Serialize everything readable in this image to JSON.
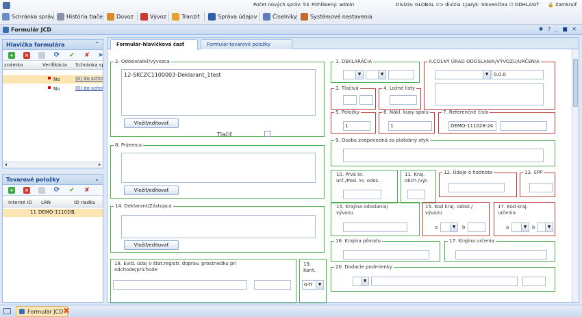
{
  "top": {
    "new_messages_label": "Počet nových správ:",
    "new_messages_count": "53",
    "logged_label": "Prihlásený:",
    "logged_user": "admin",
    "division_label": "Divízia:",
    "division_value": "GLOBAL => divízia 1",
    "language_label": "Jazyk:",
    "language_value": "Slovenčina",
    "logout": "ODHLÁSIŤ",
    "lock": "Zamknúť"
  },
  "nav": [
    "Schránka správ",
    "História tlače",
    "Dovoz",
    "Vývoz",
    "Tranzit",
    "Správa údajov",
    "Číselníky",
    "Systémové nastavenia"
  ],
  "window": {
    "title": "Formulár JCD",
    "tools": "✱ ? _ ■ ✕"
  },
  "header_panel": {
    "title": "Hlavička formulára",
    "columns": [
      "známka",
      "Verifikácia",
      "Schránka sp"
    ],
    "rows": [
      {
        "verif": "No",
        "box": "(0) do schrán"
      },
      {
        "verif": "No",
        "box": "(0) do schrán"
      }
    ]
  },
  "items_panel": {
    "title": "Tovarové položky",
    "columns": [
      "Interné ID",
      "LRN",
      "ID riadku"
    ],
    "rows": [
      {
        "id": "11",
        "lrn": "DEMO-111028",
        "line": "1"
      }
    ]
  },
  "tabs": [
    "Formulár-hlavičková časť",
    "Formulár-tovarové položky"
  ],
  "form": {
    "f2_legend": "2. Odosielateľ/vývozca",
    "f2_text": "12-SKCZC1100003-Deklarant_1test",
    "edit_btn": "Vložiť/editovať",
    "print_label": "Tlačiť",
    "f8_legend": "8. Príjemca",
    "f14_legend": "14. Deklarant/Zástupca",
    "f18_label_1": "18. Evid. údaj o štat.registr. doprav. prostriedku pri",
    "f18_label_2": "odchode/príchode",
    "f19_label_1": "19.",
    "f19_label_2": "Kont.",
    "f19_value": "0-Tr",
    "f1_legend": "1. DEKLARÁCIA",
    "fA_legend": "A.COLNÝ ÚRAD ODOSLANIA/VÝVOZU/URČENIA",
    "fA_value": "0.0.0",
    "f3_legend": "3. Tlačivá",
    "f4_legend": "4. Ložné listy",
    "f5_legend": "5. Položky",
    "f5_value": "1",
    "f6_legend": "6. Nákl. kusy spolu",
    "f6_value": "1",
    "f7_legend": "7. Referenčné číslo",
    "f7_value": "DEMO-111028-24",
    "f9_legend": "9. Osoba zodpovedná za platobný styk",
    "f10_label_1": "10. Prvá kr.",
    "f10_label_2": "urč./Posl. kr. odos.",
    "f11_label_1": "11. Kraj.",
    "f11_label_2": "obch./výr.",
    "f12_legend": "12. Údaje o hodnote",
    "f13_legend": "13. SPP",
    "f15_label_1": "15. Krajina odoslania/",
    "f15_label_2": "vývozu",
    "f15a_label_1": "15. Kod kraj. odosl./",
    "f15a_label_2": "vývozu",
    "f17a_label_1": "17. Kod kraj.",
    "f17a_label_2": "určenia",
    "a_label": "a",
    "b_label": "b",
    "f16_legend": "16. Krajina pôvodu",
    "f17_legend": "17. Krajina určenia",
    "f20_legend": "20. Dodacie podmienky"
  },
  "taskbar": {
    "tab_label": "Formulár JCD"
  }
}
